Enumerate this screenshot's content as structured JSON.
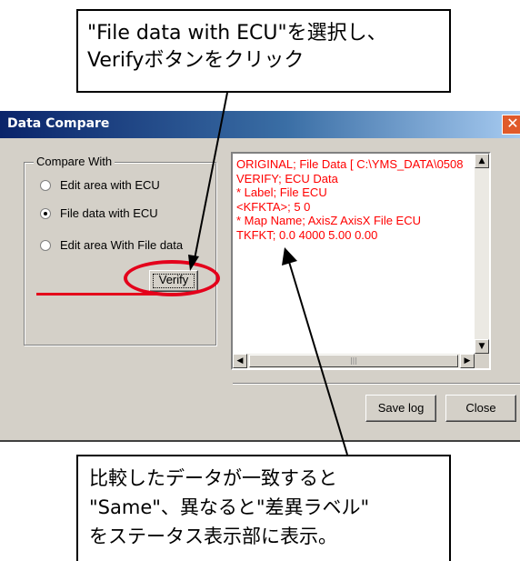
{
  "dialog": {
    "title": "Data Compare",
    "close_label": "✕",
    "compare_with": {
      "legend": "Compare With",
      "options": [
        {
          "label": "Edit area with ECU",
          "checked": false
        },
        {
          "label": "File data with ECU",
          "checked": true
        },
        {
          "label": "Edit area With File data",
          "checked": false
        }
      ]
    },
    "verify_label": "Verify",
    "log_lines": [
      "ORIGINAL; File Data  [ C:\\YMS_DATA\\0508",
      "VERIFY; ECU Data",
      "* Label; File  ECU",
      "<KFKTA>;  5  0",
      "* Map Name;  AxisZ  AxisX  File  ECU",
      "TKFKT;  0.0  4000  5.00  0.00"
    ],
    "scroll": {
      "up": "▲",
      "down": "▼",
      "left": "◀",
      "right": "▶",
      "thumb_grip": "|||"
    },
    "save_log_label": "Save log",
    "close_button_label": "Close"
  },
  "callouts": {
    "top": [
      "\"File data with ECU\"を選択し、",
      "Verifyボタンをクリック"
    ],
    "bottom": [
      "比較したデータが一致すると",
      "\"Same\"、異なると\"差異ラベル\"",
      "をステータス表示部に表示。"
    ]
  },
  "colors": {
    "annotation_red": "#e4001b",
    "log_text": "#ff0000",
    "title_bar": "#0a246a"
  }
}
